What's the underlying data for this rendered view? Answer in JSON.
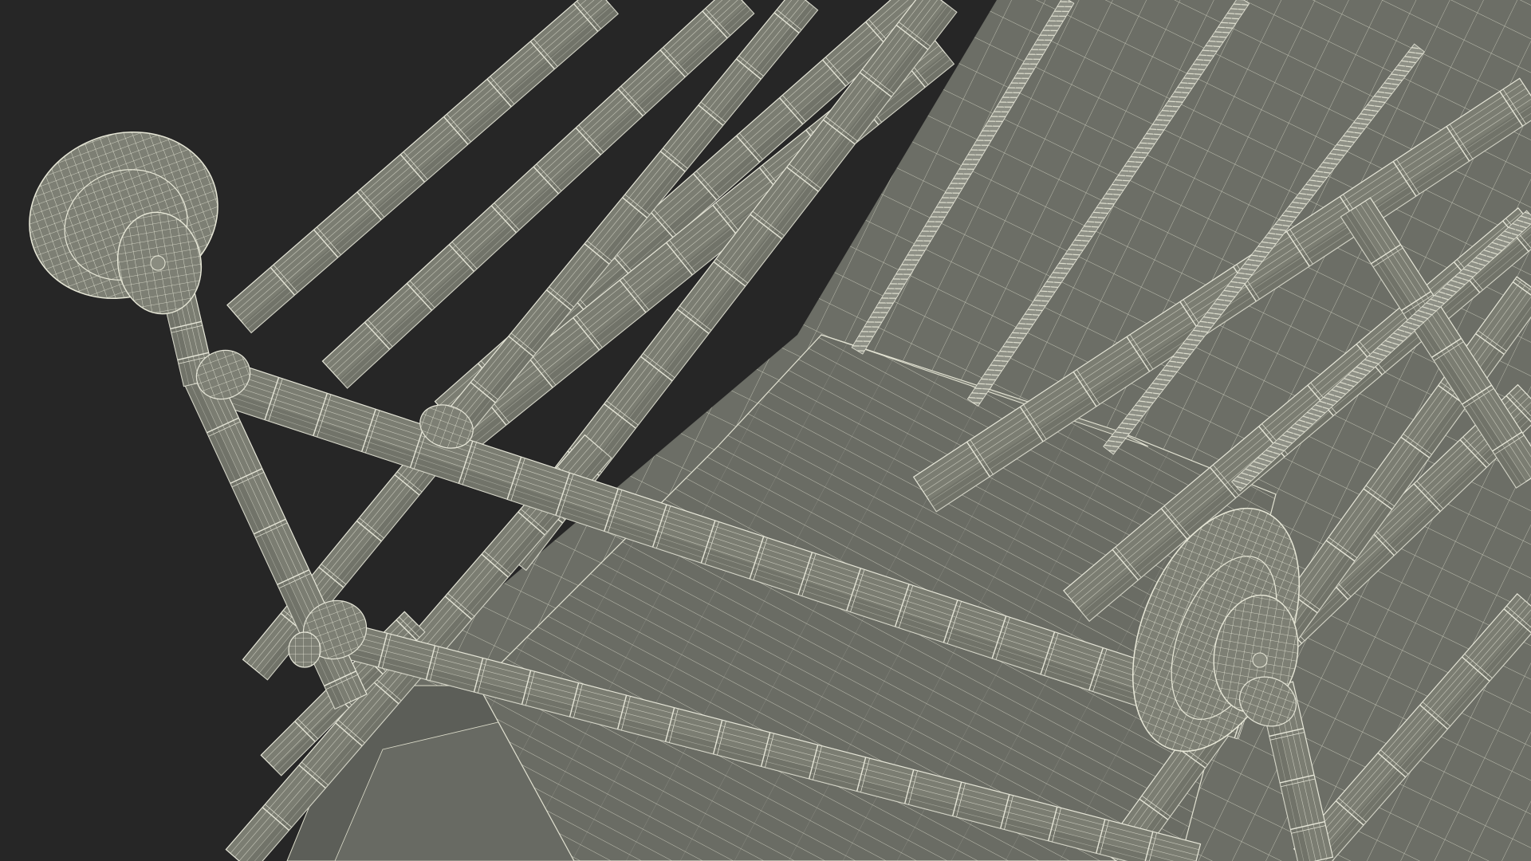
{
  "scene": {
    "subject": "wireframe-render-of-tubular-frame-with-roller-wheels-and-springs",
    "colors": {
      "background": "#262626",
      "wire": "#e6e6d8",
      "tube_fill": "#7b7d72",
      "tube_dark": "#5f615a",
      "panel_fill": "#6c6e66",
      "panel_dark": "#4e504b",
      "spring": "#9a9b90"
    }
  }
}
